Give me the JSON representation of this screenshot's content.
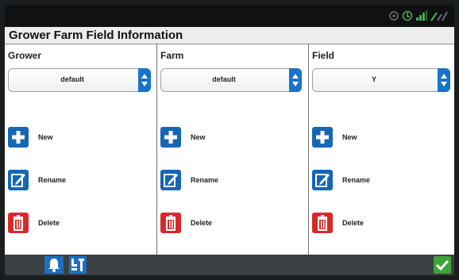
{
  "window": {
    "title": "Grower Farm Field Information"
  },
  "status_bar": {
    "icons": [
      "gps-icon",
      "signal-icon",
      "wifi-icon",
      "connection-icon"
    ]
  },
  "columns": [
    {
      "header": "Grower",
      "selected_value": "default",
      "actions": {
        "new": "New",
        "rename": "Rename",
        "delete": "Delete"
      }
    },
    {
      "header": "Farm",
      "selected_value": "default",
      "actions": {
        "new": "New",
        "rename": "Rename",
        "delete": "Delete"
      }
    },
    {
      "header": "Field",
      "selected_value": "Y",
      "actions": {
        "new": "New",
        "rename": "Rename",
        "delete": "Delete"
      }
    }
  ],
  "bottom_bar": {
    "icons": [
      "bell-icon",
      "tools-icon",
      "checkmark-icon"
    ]
  },
  "colors": {
    "accent_blue": "#1566b7",
    "delete_red": "#d62a2a",
    "confirm_green": "#3fa33a",
    "status_green": "#4caf50"
  }
}
